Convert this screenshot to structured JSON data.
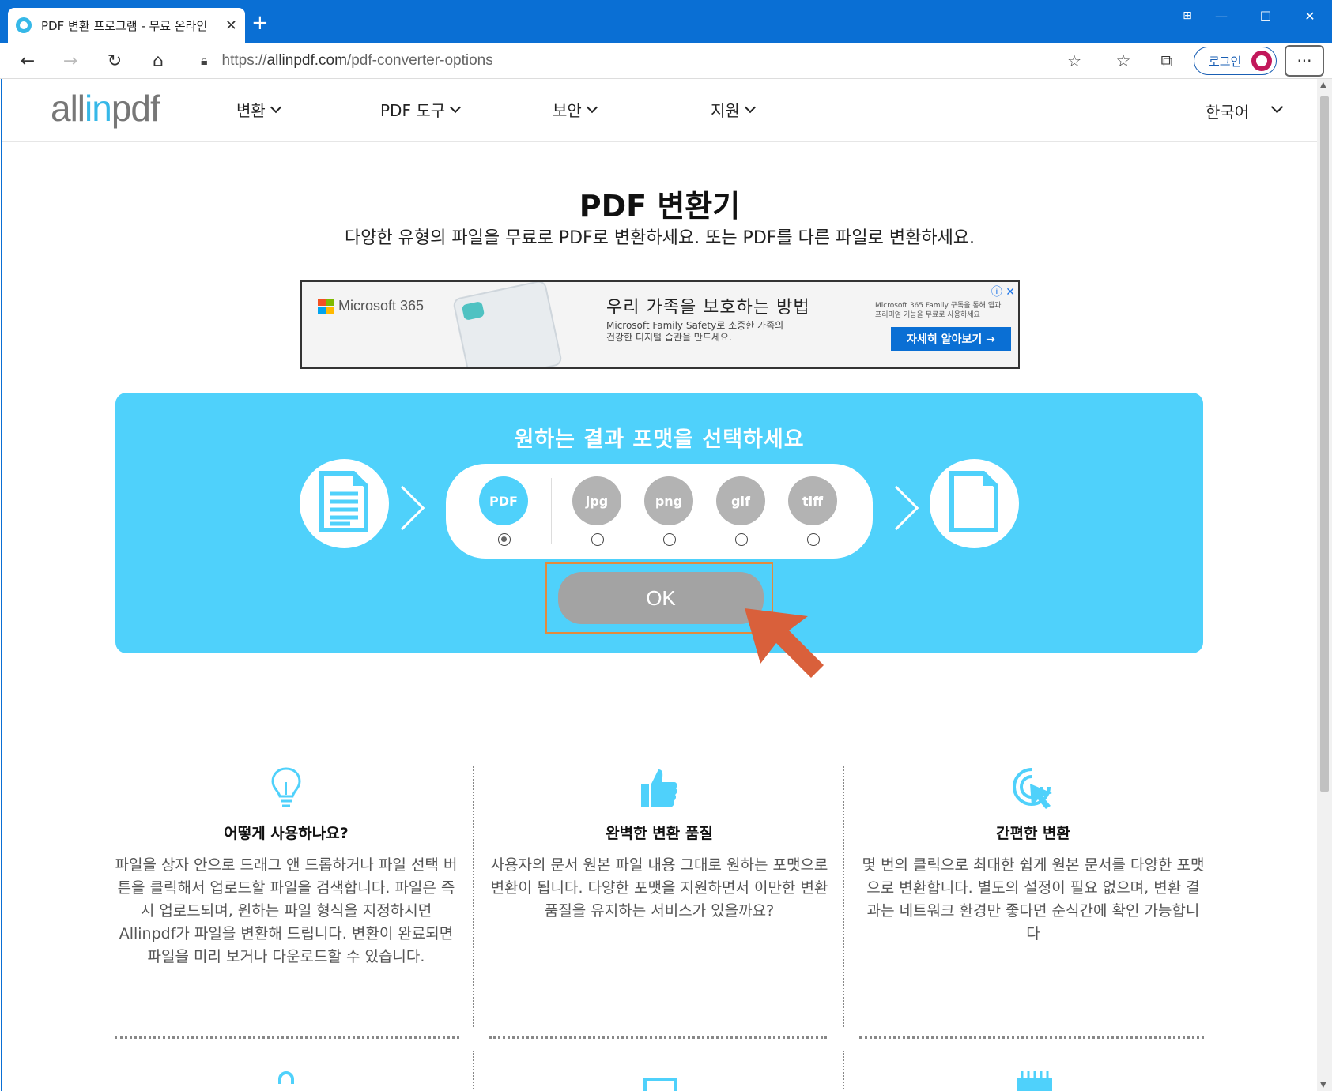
{
  "browser": {
    "tab_title": "PDF 변환 프로그램 - 무료 온라인",
    "url_prefix": "https://",
    "url_domain": "allinpdf.com",
    "url_path": "/pdf-converter-options",
    "login_label": "로그인"
  },
  "site": {
    "logo_pre": "all",
    "logo_in": "in",
    "logo_post": "pdf",
    "menu": [
      "변환",
      "PDF 도구",
      "보안",
      "지원"
    ],
    "language": "한국어"
  },
  "hero": {
    "title": "PDF 변환기",
    "subtitle": "다양한 유형의 파일을 무료로 PDF로 변환하세요. 또는 PDF를 다른 파일로 변환하세요."
  },
  "ad": {
    "brand": "Microsoft 365",
    "headline": "우리 가족을 보호하는 방법",
    "description": "Microsoft Family Safety로 소중한 가족의\n건강한 디지털 습관을 만드세요.",
    "small_text": "Microsoft 365 Family 구독을 통해 앱과\n프리미엄 기능을 무료로 사용하세요",
    "cta": "자세히 알아보기 →"
  },
  "converter": {
    "title": "원하는 결과 포맷을 선택하세요",
    "formats": [
      {
        "label": "PDF",
        "selected": true,
        "color": "#4fd1fb"
      },
      {
        "label": "jpg",
        "selected": false,
        "color": "#b3b3b3"
      },
      {
        "label": "png",
        "selected": false,
        "color": "#b3b3b3"
      },
      {
        "label": "gif",
        "selected": false,
        "color": "#b3b3b3"
      },
      {
        "label": "tiff",
        "selected": false,
        "color": "#b3b3b3"
      }
    ],
    "ok_label": "OK"
  },
  "features": [
    {
      "icon": "lightbulb-icon",
      "title": "어떻게 사용하나요?",
      "body": "파일을 상자 안으로 드래그 앤 드롭하거나 파일 선택 버튼을 클릭해서 업로드할 파일을 검색합니다. 파일은 즉시 업로드되며, 원하는 파일 형식을 지정하시면 Allinpdf가 파일을 변환해 드립니다. 변환이 완료되면 파일을 미리 보거나 다운로드할 수 있습니다."
    },
    {
      "icon": "thumbs-up-icon",
      "title": "완벽한 변환 품질",
      "body": "사용자의 문서 원본 파일 내용 그대로 원하는 포맷으로 변환이 됩니다. 다양한 포맷을 지원하면서 이만한 변환 품질을 유지하는 서비스가 있을까요?"
    },
    {
      "icon": "click-icon",
      "title": "간편한 변환",
      "body": "몇 번의 클릭으로 최대한 쉽게 원본 문서를 다양한 포맷으로 변환합니다. 별도의 설정이 필요 없으며, 변환 결과는 네트워크 환경만 좋다면 순식간에 확인 가능합니다"
    }
  ],
  "colors": {
    "accent": "#4fd1fb",
    "browser_blue": "#0a6fd4",
    "pointer": "#d9603b"
  }
}
